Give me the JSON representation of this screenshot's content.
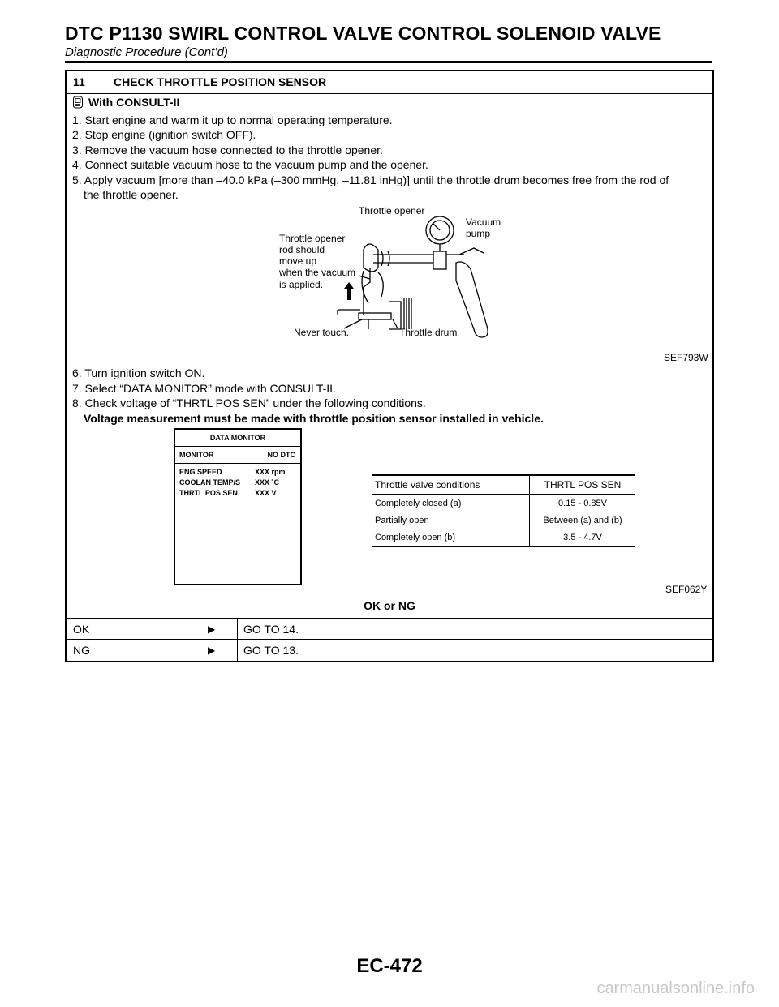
{
  "header": {
    "title": "DTC P1130 SWIRL CONTROL VALVE CONTROL SOLENOID VALVE",
    "subtitle": "Diagnostic Procedure (Cont’d)"
  },
  "step": {
    "number": "11",
    "title": "CHECK THROTTLE POSITION SENSOR"
  },
  "procedure": {
    "with_label": "With CONSULT-II",
    "lines_a": [
      "1. Start engine and warm it up to normal operating temperature.",
      "2. Stop engine (ignition switch OFF).",
      "3. Remove the vacuum hose connected to the throttle opener.",
      "4. Connect suitable vacuum hose to the vacuum pump and the opener.",
      "5. Apply vacuum [more than –40.0 kPa (–300 mmHg, –11.81 inHg)] until the throttle drum becomes free from the rod of",
      "the throttle opener."
    ],
    "lines_b": [
      "6. Turn ignition switch ON.",
      "7. Select “DATA MONITOR” mode with CONSULT-II.",
      "8. Check voltage of “THRTL POS SEN” under the following conditions."
    ],
    "note": "Voltage measurement must be made with throttle position sensor installed in vehicle."
  },
  "figure1": {
    "code": "SEF793W",
    "labels": {
      "throttle_opener": "Throttle opener",
      "vacuum_pump_1": "Vacuum",
      "vacuum_pump_2": "pump",
      "rod_1": "Throttle opener",
      "rod_2": "rod should",
      "rod_3": "move up",
      "rod_4": "when the vacuum",
      "rod_5": "is applied.",
      "never_touch": "Never touch.",
      "throttle_drum": "Throttle drum"
    }
  },
  "figure2": {
    "code": "SEF062Y",
    "data_monitor": {
      "title": "DATA MONITOR",
      "monitor": "MONITOR",
      "no_dtc": "NO DTC",
      "rows": [
        {
          "name": "ENG SPEED",
          "value": "XXX rpm"
        },
        {
          "name": "COOLAN TEMP/S",
          "value": "XXX ˚C"
        },
        {
          "name": "THRTL POS SEN",
          "value": "XXX V"
        }
      ]
    },
    "table": {
      "headers": [
        "Throttle valve conditions",
        "THRTL POS SEN"
      ],
      "rows": [
        [
          "Completely closed (a)",
          "0.15 - 0.85V"
        ],
        [
          "Partially open",
          "Between (a) and (b)"
        ],
        [
          "Completely open (b)",
          "3.5 - 4.7V"
        ]
      ]
    }
  },
  "result": {
    "label": "OK or NG",
    "rows": [
      {
        "key": "OK",
        "value": "GO TO 14."
      },
      {
        "key": "NG",
        "value": "GO TO 13."
      }
    ]
  },
  "footer": {
    "page": "EC-472",
    "watermark": "carmanualsonline.info"
  }
}
